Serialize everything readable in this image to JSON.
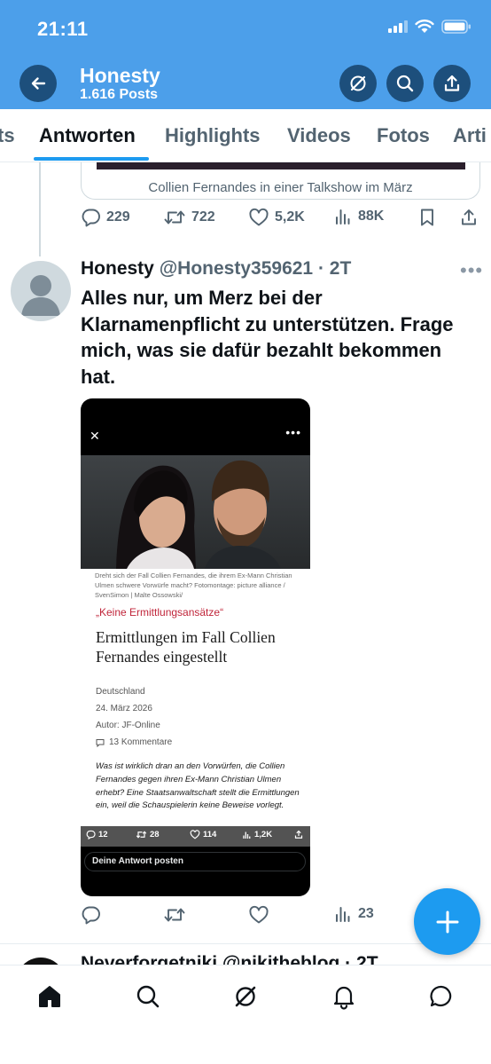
{
  "status_bar": {
    "time": "21:11"
  },
  "header": {
    "title": "Honesty",
    "subtitle": "1.616 Posts",
    "colors": {
      "background": "#4c9fea",
      "button": "#1d4f7c"
    },
    "icons": [
      "back-arrow-icon",
      "grok-icon",
      "search-icon",
      "share-icon"
    ]
  },
  "tabs": [
    {
      "label": "ts"
    },
    {
      "label": "Antworten",
      "active": true
    },
    {
      "label": "Highlights"
    },
    {
      "label": "Videos"
    },
    {
      "label": "Fotos"
    },
    {
      "label": "Arti"
    }
  ],
  "previous_tweet": {
    "media_caption": "Collien Fernandes in einer Talkshow im März",
    "replies": "229",
    "reposts": "722",
    "likes": "5,2K",
    "views": "88K"
  },
  "tweet": {
    "name": "Honesty",
    "handle_time": "@Honesty359621 · 2T",
    "text": "Alles nur, um Merz bei der Klarnamenpflicht zu unterstützen. Frage mich, was sie dafür bezahlt bekommen hat.",
    "views": "23",
    "screenshot": {
      "caption": "Dreht sich der Fall Collien Fernandes, die ihrem Ex-Mann Christian Ulmen schwere Vorwürfe macht? Fotomontage: picture alliance / SvenSimon | Malte Ossowski/",
      "kicker": "„Keine Ermittlungsansätze“",
      "headline": "Ermittlungen im Fall Collien Fernandes eingestellt",
      "category": "Deutschland",
      "date": "24. März 2026",
      "author": "Autor: JF-Online",
      "comments": "13 Kommentare",
      "lede": "Was ist wirklich dran an den Vorwürfen, die Collien Fernandes gegen ihren Ex-Mann Christian Ulmen erhebt? Eine Staatsanwaltschaft stellt die Ermittlungen ein, weil die Schauspielerin keine Beweise vorlegt.",
      "replies": "12",
      "reposts": "28",
      "likes": "114",
      "views": "1,2K",
      "reply_placeholder": "Deine Antwort posten"
    }
  },
  "next_tweet": {
    "header": "Neverforgetniki  @nikitheblog  · 2T"
  },
  "accent_color": "#1d9bf0",
  "bottom_nav": [
    "home-icon",
    "search-icon",
    "grok-icon",
    "notifications-icon",
    "messages-icon"
  ]
}
